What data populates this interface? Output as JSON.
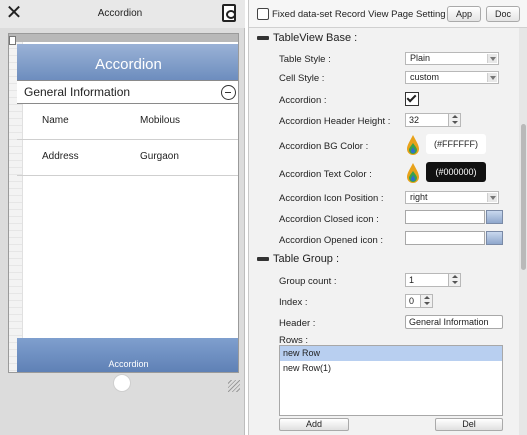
{
  "device": {
    "title": "Accordion",
    "nav_title": "Accordion",
    "accordion_header": "General Information",
    "rows": [
      {
        "key": "Name",
        "value": "Mobilous"
      },
      {
        "key": "Address",
        "value": "Gurgaon"
      }
    ],
    "footer_label": "Accordion"
  },
  "panel": {
    "title": "Fixed data-set Record View Page Setting",
    "app_button": "App",
    "doc_button": "Doc",
    "section_tableview": "TableView Base :",
    "section_tablegroup": "Table Group :",
    "props": {
      "table_style_label": "Table Style :",
      "table_style_value": "Plain",
      "cell_style_label": "Cell Style :",
      "cell_style_value": "custom",
      "accordion_label": "Accordion :",
      "accordion_checked": true,
      "header_height_label": "Accordion Header Height :",
      "header_height_value": "32",
      "bg_color_label": "Accordion BG Color :",
      "bg_color_value": "(#FFFFFF)",
      "text_color_label": "Accordion Text Color :",
      "text_color_value": "(#000000)",
      "icon_position_label": "Accordion Icon Position :",
      "icon_position_value": "right",
      "closed_icon_label": "Accordion Closed icon :",
      "opened_icon_label": "Accordion Opened icon :",
      "group_count_label": "Group count :",
      "group_count_value": "1",
      "index_label": "Index :",
      "index_value": "0",
      "header_label": "Header :",
      "header_value": "General Information",
      "rows_label": "Rows :"
    },
    "rows_list": [
      "new Row",
      "new Row(1)"
    ],
    "add_button": "Add",
    "del_button": "Del"
  },
  "colors": {
    "nav_bar": "#6d8dbe",
    "selected_row": "#b8cff0",
    "accordion_bg": "#FFFFFF",
    "accordion_text": "#000000"
  }
}
